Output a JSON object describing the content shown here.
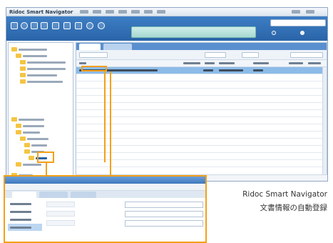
{
  "app": {
    "title": "Ridoc Smart Navigator"
  },
  "caption": {
    "product": "Ridoc Smart Navigator",
    "feature": "文書情報の自動登録"
  },
  "colors": {
    "accent": "#2a64a8",
    "highlight_callout": "#f3a018",
    "selected_row": "#8cbbe8"
  },
  "icons": [
    "new-document-icon",
    "search-icon",
    "print-icon",
    "close-icon",
    "edit-icon",
    "star-icon",
    "settings-icon"
  ]
}
